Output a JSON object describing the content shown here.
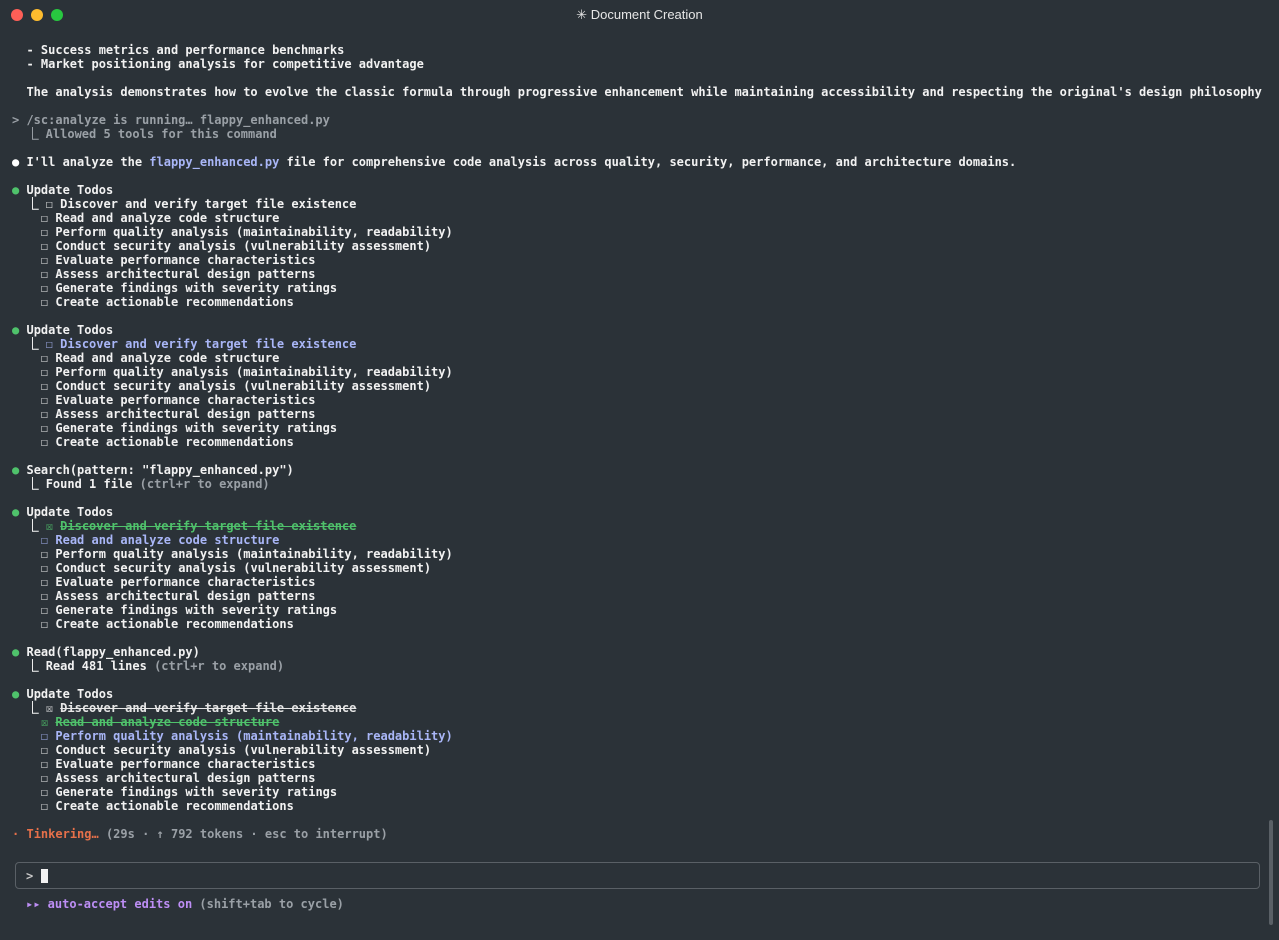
{
  "window": {
    "title": "✳ Document Creation"
  },
  "intro": {
    "bullet1": "  - Success metrics and performance benchmarks",
    "bullet2": "  - Market positioning analysis for competitive advantage",
    "summary": "  The analysis demonstrates how to evolve the classic formula through progressive enhancement while maintaining accessibility and respecting the original's design philosophy."
  },
  "command": {
    "line": "> /sc:analyze is running… flappy_enhanced.py",
    "tools": "  ⎿ Allowed 5 tools for this command"
  },
  "analyze_msg": {
    "bullet": "●",
    "prefix": " I'll analyze the ",
    "file": "flappy_enhanced.py",
    "suffix": " file for comprehensive code analysis across quality, security, performance, and architecture domains."
  },
  "todo_blocks": [
    {
      "header": "Update Todos",
      "items": [
        {
          "box": "☐",
          "label": "Discover and verify target file existence"
        },
        {
          "box": "☐",
          "label": "Read and analyze code structure"
        },
        {
          "box": "☐",
          "label": "Perform quality analysis (maintainability, readability)"
        },
        {
          "box": "☐",
          "label": "Conduct security analysis (vulnerability assessment)"
        },
        {
          "box": "☐",
          "label": "Evaluate performance characteristics"
        },
        {
          "box": "☐",
          "label": "Assess architectural design patterns"
        },
        {
          "box": "☐",
          "label": "Generate findings with severity ratings"
        },
        {
          "box": "☐",
          "label": "Create actionable recommendations"
        }
      ]
    },
    {
      "header": "Update Todos",
      "items": [
        {
          "box": "☐",
          "label": "Discover and verify target file existence"
        },
        {
          "box": "☐",
          "label": "Read and analyze code structure"
        },
        {
          "box": "☐",
          "label": "Perform quality analysis (maintainability, readability)"
        },
        {
          "box": "☐",
          "label": "Conduct security analysis (vulnerability assessment)"
        },
        {
          "box": "☐",
          "label": "Evaluate performance characteristics"
        },
        {
          "box": "☐",
          "label": "Assess architectural design patterns"
        },
        {
          "box": "☐",
          "label": "Generate findings with severity ratings"
        },
        {
          "box": "☐",
          "label": "Create actionable recommendations"
        }
      ]
    },
    {
      "header": "Update Todos",
      "items": [
        {
          "box": "☒",
          "label": "Discover and verify target file existence"
        },
        {
          "box": "☐",
          "label": "Read and analyze code structure"
        },
        {
          "box": "☐",
          "label": "Perform quality analysis (maintainability, readability)"
        },
        {
          "box": "☐",
          "label": "Conduct security analysis (vulnerability assessment)"
        },
        {
          "box": "☐",
          "label": "Evaluate performance characteristics"
        },
        {
          "box": "☐",
          "label": "Assess architectural design patterns"
        },
        {
          "box": "☐",
          "label": "Generate findings with severity ratings"
        },
        {
          "box": "☐",
          "label": "Create actionable recommendations"
        }
      ]
    },
    {
      "header": "Update Todos",
      "items": [
        {
          "box": "☒",
          "label": "Discover and verify target file existence"
        },
        {
          "box": "☒",
          "label": "Read and analyze code structure"
        },
        {
          "box": "☐",
          "label": "Perform quality analysis (maintainability, readability)"
        },
        {
          "box": "☐",
          "label": "Conduct security analysis (vulnerability assessment)"
        },
        {
          "box": "☐",
          "label": "Evaluate performance characteristics"
        },
        {
          "box": "☐",
          "label": "Assess architectural design patterns"
        },
        {
          "box": "☐",
          "label": "Generate findings with severity ratings"
        },
        {
          "box": "☐",
          "label": "Create actionable recommendations"
        }
      ]
    }
  ],
  "search": {
    "call": "Search(pattern: \"flappy_enhanced.py\")",
    "result": "Found 1 file",
    "hint": " (ctrl+r to expand)"
  },
  "read": {
    "call": "Read(flappy_enhanced.py)",
    "result": "Read 481 lines",
    "hint": " (ctrl+r to expand)"
  },
  "status": {
    "spinner": "·",
    "verb": "Tinkering…",
    "detail": " (29s · ↑ 792 tokens · esc to interrupt)"
  },
  "input": {
    "prompt": ">"
  },
  "footer": {
    "arrows": "▸▸",
    "mode": " auto-accept edits on",
    "hint": " (shift+tab to cycle)"
  },
  "colors": {
    "background": "#2b3238",
    "accent_blue": "#a9b6f7",
    "success_green": "#4fc26b",
    "spinner_orange": "#e5704a",
    "mode_purple": "#bd8ef5"
  }
}
